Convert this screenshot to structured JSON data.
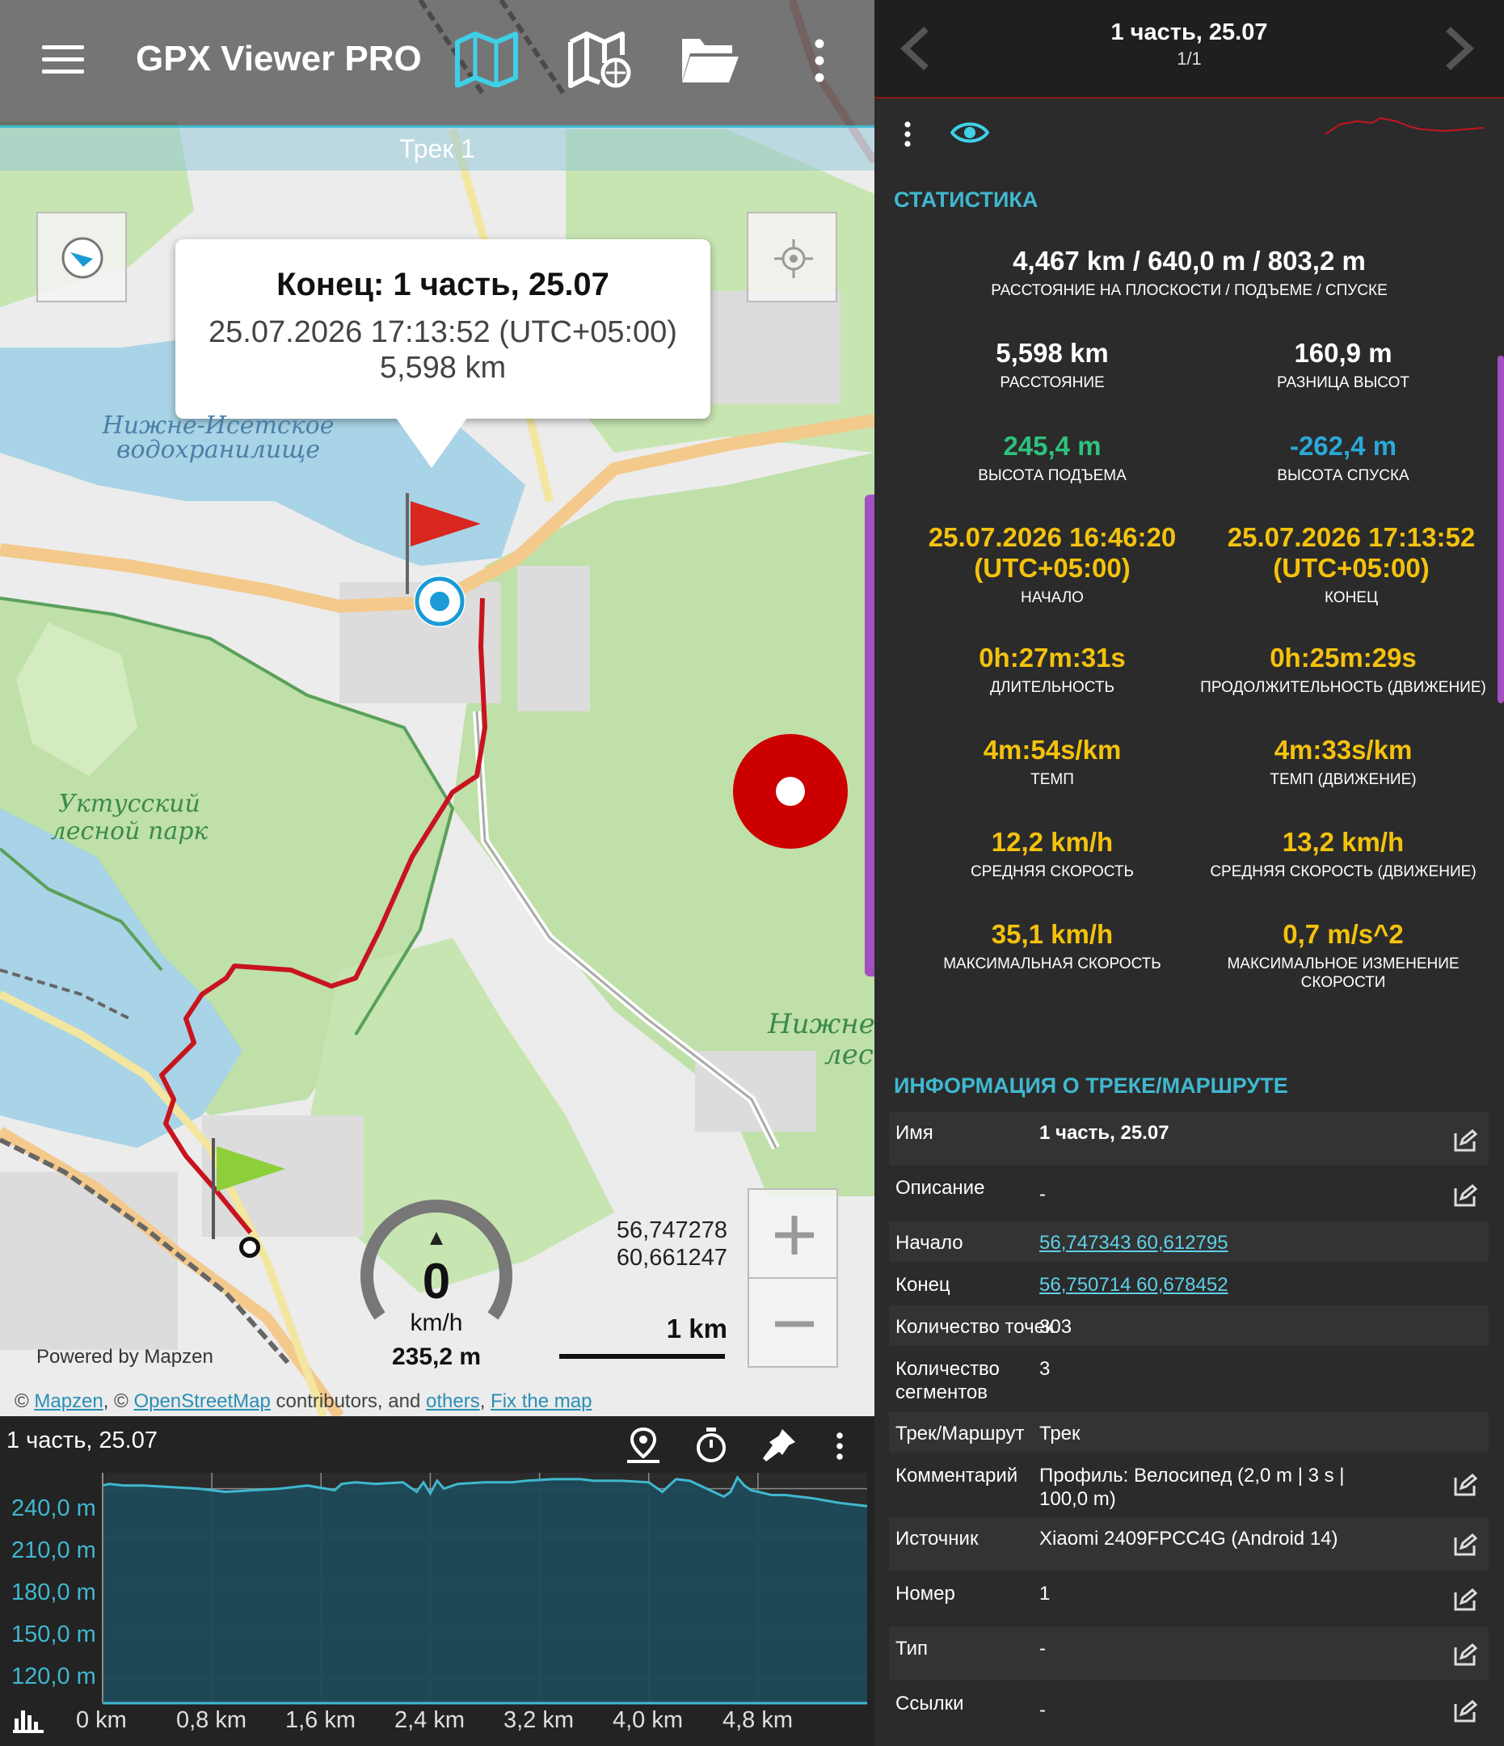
{
  "app": {
    "title": "GPX Viewer PRO"
  },
  "map": {
    "track_tab": "Трек 1",
    "popup": {
      "title": "Конец: 1 часть, 25.07",
      "time": "25.07.2026 17:13:52 (UTC+05:00)",
      "distance": "5,598 km"
    },
    "labels": {
      "reservoir": [
        "Нижне-Исетское",
        "водохранилище"
      ],
      "park": [
        "Уктусский",
        "лесной парк"
      ],
      "forest_cut": [
        "Нижне",
        "лес"
      ]
    },
    "speedometer": {
      "value": "0",
      "unit": "km/h",
      "altitude": "235,2 m"
    },
    "coords": [
      "56,747278",
      "60,661247"
    ],
    "scale": "1 km",
    "powered_by": "Powered by Mapzen",
    "attribution": {
      "c1": "© ",
      "mapzen": "Mapzen",
      "c2": ", © ",
      "osm": "OpenStreetMap",
      "c3": " contributors, and ",
      "others": "others",
      "c4": ", ",
      "fix": "Fix the map"
    }
  },
  "chart_panel": {
    "title": "1 часть, 25.07"
  },
  "chart_data": {
    "type": "area",
    "title": "",
    "xlabel": "",
    "ylabel": "",
    "x_unit": "km",
    "y_unit": "m",
    "xlim": [
      0,
      5.6
    ],
    "ylim": [
      105,
      250
    ],
    "x_ticks": [
      "0 km",
      "0,8 km",
      "1,6 km",
      "2,4 km",
      "3,2 km",
      "4,0 km",
      "4,8 km"
    ],
    "y_ticks": [
      "240,0 m",
      "210,0 m",
      "180,0 m",
      "150,0 m",
      "120,0 m"
    ],
    "series": [
      {
        "x": [
          0,
          0.05,
          0.15,
          0.3,
          0.5,
          0.7,
          0.9,
          1.1,
          1.3,
          1.5,
          1.7,
          1.75,
          1.85,
          2.0,
          2.2,
          2.3,
          2.35,
          2.4,
          2.45,
          2.5,
          2.6,
          2.8,
          3.0,
          3.1,
          3.3,
          3.5,
          3.6,
          3.8,
          4.0,
          4.1,
          4.2,
          4.3,
          4.45,
          4.55,
          4.6,
          4.65,
          4.7,
          4.75,
          4.8,
          4.9,
          5.0,
          5.2,
          5.4,
          5.6
        ],
        "y": [
          242,
          243,
          242,
          242,
          241,
          240,
          238,
          239,
          240,
          242,
          239,
          243,
          244,
          243,
          244,
          238,
          244,
          237,
          245,
          240,
          243,
          244,
          244,
          245,
          246,
          246,
          245,
          245,
          244,
          238,
          246,
          245,
          239,
          235,
          238,
          247,
          242,
          239,
          238,
          236,
          236,
          234,
          231,
          229
        ]
      }
    ]
  },
  "right": {
    "header": {
      "title": "1 часть, 25.07",
      "subtitle": "1/1"
    },
    "stats_title": "СТАТИСТИКА",
    "stats_main": {
      "value": "4,467 km / 640,0 m / 803,2 m",
      "label": "РАССТОЯНИЕ НА ПЛОСКОСТИ / ПОДЪЕМЕ / СПУСКЕ"
    },
    "stats": [
      {
        "value": "5,598 km",
        "label": "РАССТОЯНИЕ"
      },
      {
        "value": "160,9 m",
        "label": "РАЗНИЦА ВЫСОТ"
      },
      {
        "value": "245,4 m",
        "label": "ВЫСОТА ПОДЪЕМА"
      },
      {
        "value": "-262,4 m",
        "label": "ВЫСОТА СПУСКА"
      },
      {
        "value": "25.07.2026 16:46:20 (UTC+05:00)",
        "label": "НАЧАЛО"
      },
      {
        "value": "25.07.2026 17:13:52 (UTC+05:00)",
        "label": "КОНЕЦ"
      },
      {
        "value": "0h:27m:31s",
        "label": "ДЛИТЕЛЬНОСТЬ"
      },
      {
        "value": "0h:25m:29s",
        "label": "ПРОДОЛЖИТЕЛЬНОСТЬ (ДВИЖЕНИЕ)"
      },
      {
        "value": "4m:54s/km",
        "label": "ТЕМП"
      },
      {
        "value": "4m:33s/km",
        "label": "ТЕМП (ДВИЖЕНИЕ)"
      },
      {
        "value": "12,2 km/h",
        "label": "СРЕДНЯЯ СКОРОСТЬ"
      },
      {
        "value": "13,2 km/h",
        "label": "СРЕДНЯЯ СКОРОСТЬ (ДВИЖЕНИЕ)"
      },
      {
        "value": "35,1 km/h",
        "label": "МАКСИМАЛЬНАЯ СКОРОСТЬ"
      },
      {
        "value": "0,7 m/s^2",
        "label": "МАКСИМАЛЬНОЕ ИЗМЕНЕНИЕ СКОРОСТИ"
      }
    ],
    "info_title": "ИНФОРМАЦИЯ О ТРЕКЕ/МАРШРУТЕ",
    "info": [
      {
        "key": "Имя",
        "value": "1 часть, 25.07"
      },
      {
        "key": "Описание",
        "value": "-"
      },
      {
        "key": "Начало",
        "value": "56,747343 60,612795"
      },
      {
        "key": "Конец",
        "value": "56,750714 60,678452"
      },
      {
        "key": "Количество точек",
        "value": "303"
      },
      {
        "key": "Количество сегментов",
        "value": "3"
      },
      {
        "key": "Трек/Маршрут",
        "value": "Трек"
      },
      {
        "key": "Комментарий",
        "value": "Профиль: Велосипед (2,0 m | 3 s | 100,0 m)"
      },
      {
        "key": "Источник",
        "value": "Xiaomi 2409FPCC4G (Android 14)"
      },
      {
        "key": "Номер",
        "value": "1"
      },
      {
        "key": "Тип",
        "value": "-"
      },
      {
        "key": "Ссылки",
        "value": "-"
      }
    ]
  },
  "colors": {
    "accent": "#3fb8d0",
    "stat_green": "#2ec27e",
    "stat_blue": "#29a9d8",
    "stat_yellow": "#f4c20d",
    "track_red": "#c8141e"
  },
  "icons": [
    "menu-icon",
    "map-icon",
    "map-globe-icon",
    "folder-icon",
    "more-vert-icon",
    "compass-icon",
    "locate-icon",
    "red-flag-icon",
    "green-flag-icon",
    "location-dot-icon",
    "record-button-icon",
    "zoom-in-icon",
    "zoom-out-icon",
    "route-pin-icon",
    "stopwatch-icon",
    "pin-icon",
    "chart-bars-icon",
    "chevron-left-icon",
    "chevron-right-icon",
    "eye-icon",
    "edit-icon"
  ]
}
